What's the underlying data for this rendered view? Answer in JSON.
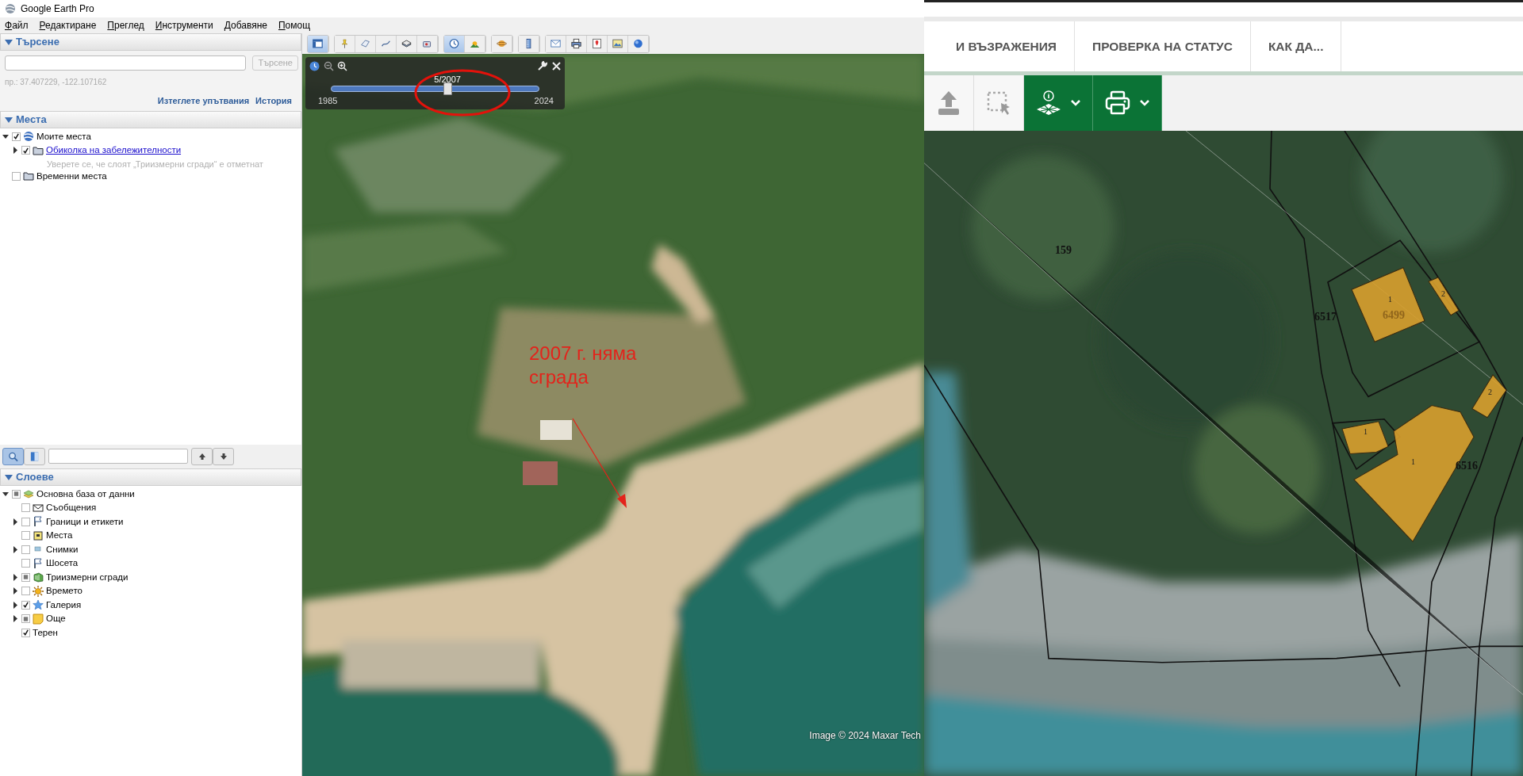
{
  "window": {
    "title": "Google Earth Pro"
  },
  "menu": [
    "Файл",
    "Редактиране",
    "Преглед",
    "Инструменти",
    "Добавяне",
    "Помощ"
  ],
  "search_panel": {
    "title": "Търсене",
    "expanded": true,
    "button": "Търсене",
    "button_disabled": true,
    "hint": "пр.: 37.407229, -122.107162",
    "links": [
      "Изтеглете упътвания",
      "История"
    ]
  },
  "places_panel": {
    "title": "Места",
    "expanded": true,
    "items": [
      {
        "label": "Моите места",
        "kind": "globe",
        "checked": true,
        "expanded": true,
        "link": false,
        "children": [
          {
            "label": "Обиколка на забележителности",
            "kind": "folder",
            "checked": true,
            "expanded": false,
            "link": true,
            "note": "Уверете се, че слоят „Триизмерни сгради“ е отметнат"
          }
        ]
      },
      {
        "label": "Временни места",
        "kind": "folder",
        "checked": false,
        "link": false
      }
    ]
  },
  "layers_toolbar": {
    "modes": [
      {
        "kind": "search",
        "selected": true
      },
      {
        "kind": "panel",
        "selected": false
      }
    ]
  },
  "layers_panel": {
    "title": "Слоеве",
    "expanded": true,
    "items": [
      {
        "label": "Основна база от данни",
        "kind": "layers",
        "checked": true,
        "partial": true,
        "expanded": true,
        "children": [
          {
            "label": "Съобщения",
            "kind": "envelope",
            "checked": false
          },
          {
            "label": "Граници и етикети",
            "kind": "flag",
            "checked": false,
            "expanded": false
          },
          {
            "label": "Места",
            "kind": "place",
            "checked": false
          },
          {
            "label": "Снимки",
            "kind": "photo",
            "checked": false,
            "expanded": false
          },
          {
            "label": "Шосета",
            "kind": "flag",
            "checked": false
          },
          {
            "label": "Триизмерни сгради",
            "kind": "building",
            "checked": true,
            "partial": true,
            "expanded": false
          },
          {
            "label": "Времето",
            "kind": "sun",
            "checked": false,
            "expanded": false
          },
          {
            "label": "Галерия",
            "kind": "star",
            "checked": true,
            "expanded": false
          },
          {
            "label": "Още",
            "kind": "note",
            "checked": true,
            "partial": true,
            "expanded": false
          },
          {
            "label": "Терен",
            "checked": true
          }
        ]
      }
    ]
  },
  "toolbar": [
    [
      {
        "kind": "sidebar",
        "selected": true
      }
    ],
    [
      {
        "kind": "placemark",
        "selected": false
      },
      {
        "kind": "polygon",
        "selected": false
      },
      {
        "kind": "path",
        "selected": false
      },
      {
        "kind": "overlay",
        "selected": false
      },
      {
        "kind": "tour",
        "selected": false
      }
    ],
    [
      {
        "kind": "history",
        "selected": true
      },
      {
        "kind": "sun",
        "selected": false
      }
    ],
    [
      {
        "kind": "planet",
        "selected": false
      }
    ],
    [
      {
        "kind": "ruler",
        "selected": false
      }
    ],
    [
      {
        "kind": "email",
        "selected": false
      },
      {
        "kind": "print",
        "selected": false
      },
      {
        "kind": "maps",
        "selected": false
      },
      {
        "kind": "image",
        "selected": false
      },
      {
        "kind": "earth",
        "selected": false
      }
    ]
  ],
  "time_slider": {
    "date": "5/2007",
    "start": "1985",
    "end": "2024",
    "level": 0.56
  },
  "annotation": {
    "text": "2007 г. няма сграда"
  },
  "attribution": "Image © 2024 Maxar Tech",
  "cadastre": {
    "tabs": [
      "И ВЪЗРАЖЕНИЯ",
      "ПРОВЕРКА НА СТАТУС",
      "КАК ДА..."
    ],
    "tools": [
      {
        "kind": "upload",
        "active": false,
        "dropdown": false
      },
      {
        "kind": "select",
        "active": false,
        "dropdown": false
      },
      {
        "kind": "identify",
        "active": true,
        "dropdown": true
      },
      {
        "kind": "print",
        "active": true,
        "dropdown": true
      }
    ],
    "parcels": [
      "159",
      "6517",
      "6499",
      "6516"
    ],
    "buildings": [
      "1",
      "2",
      "2",
      "1",
      "1"
    ]
  }
}
